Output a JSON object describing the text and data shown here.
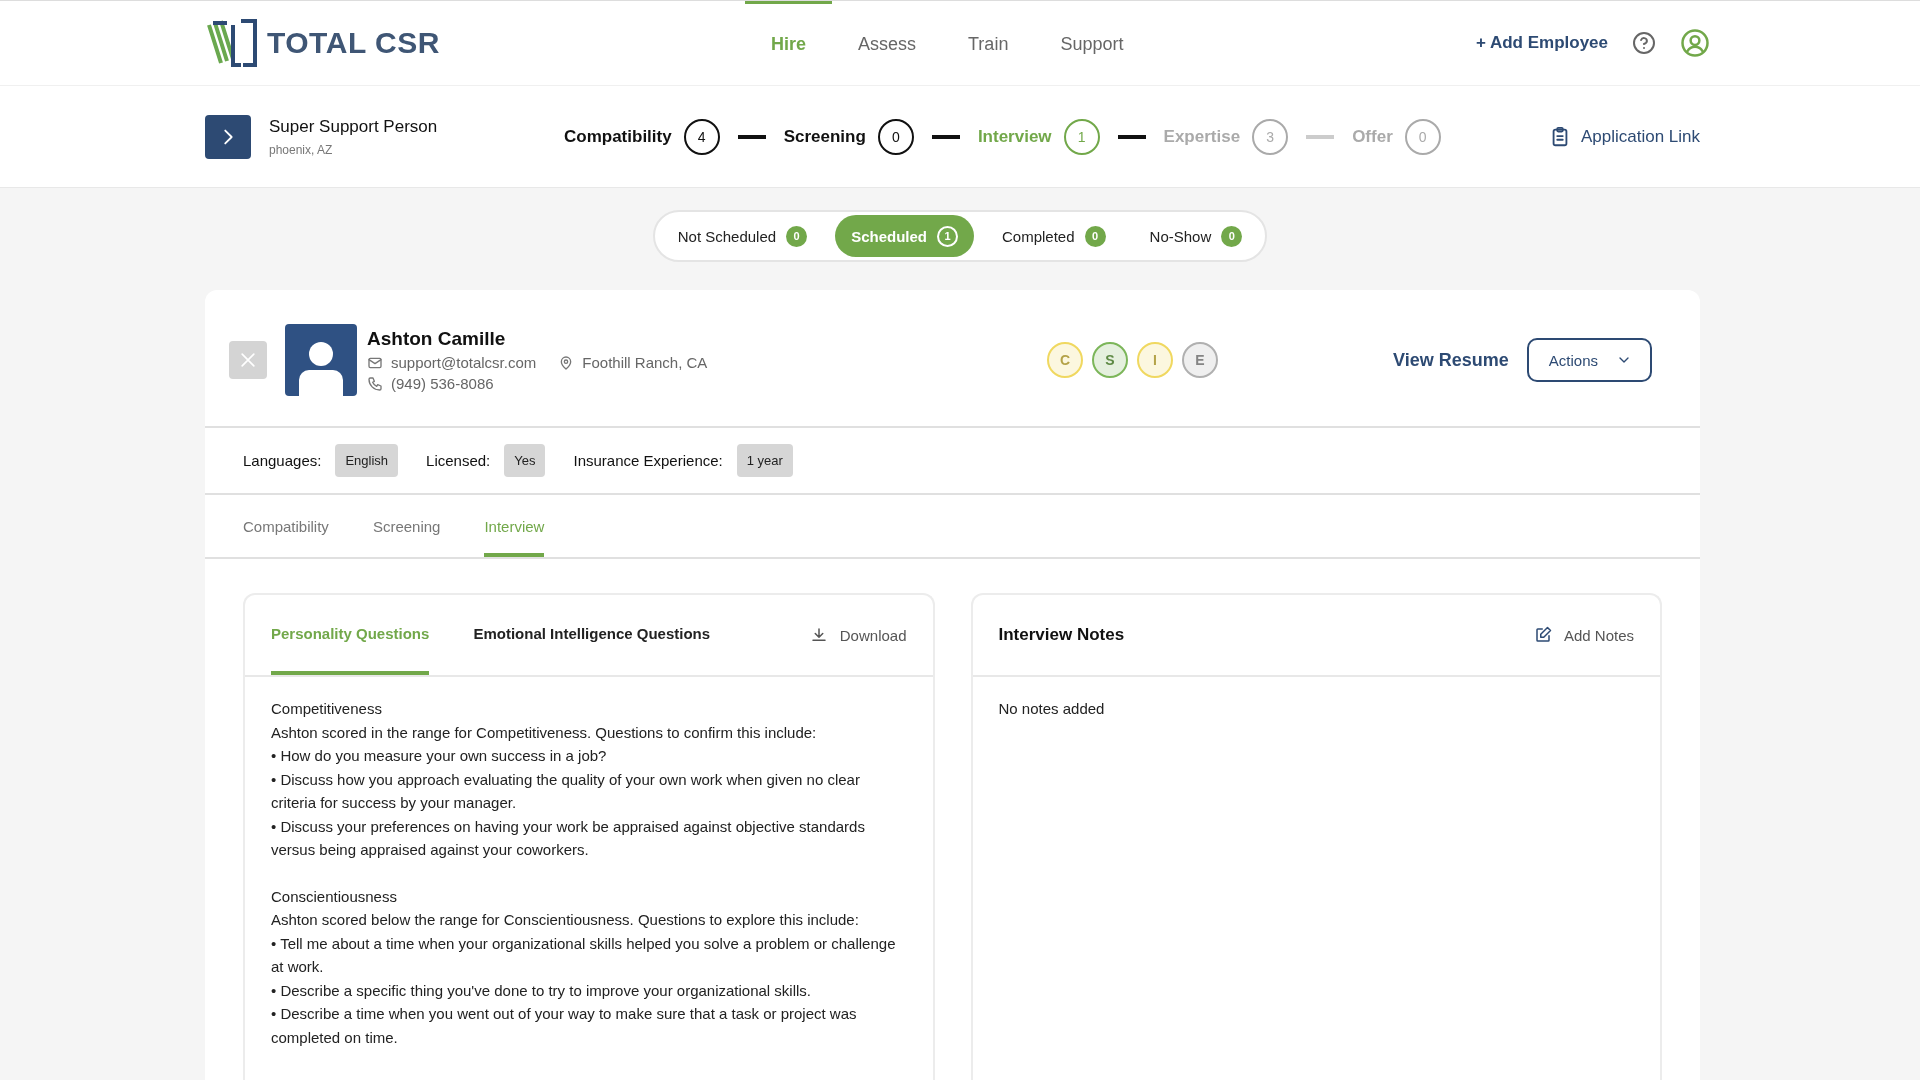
{
  "logo": {
    "text": "TOTAL CSR"
  },
  "nav": [
    {
      "label": "Hire",
      "selected": true
    },
    {
      "label": "Assess",
      "selected": false
    },
    {
      "label": "Train",
      "selected": false
    },
    {
      "label": "Support",
      "selected": false
    }
  ],
  "add_employee": "+ Add Employee",
  "job": {
    "title": "Super Support Person",
    "location": "phoenix, AZ"
  },
  "pipeline": [
    {
      "label": "Compatibility",
      "count": "4",
      "completed": true,
      "selected": false
    },
    {
      "label": "Screening",
      "count": "0",
      "completed": true,
      "selected": false
    },
    {
      "label": "Interview",
      "count": "1",
      "completed": false,
      "selected": true
    },
    {
      "label": "Expertise",
      "count": "3",
      "completed": false,
      "selected": false
    },
    {
      "label": "Offer",
      "count": "0",
      "completed": false,
      "selected": false
    }
  ],
  "application_link": "Application Link",
  "filters": [
    {
      "label": "Not Scheduled",
      "count": "0",
      "selected": false
    },
    {
      "label": "Scheduled",
      "count": "1",
      "selected": true
    },
    {
      "label": "Completed",
      "count": "0",
      "selected": false
    },
    {
      "label": "No-Show",
      "count": "0",
      "selected": false
    }
  ],
  "candidate": {
    "name": "Ashton Camille",
    "email": "support@totalcsr.com",
    "location": "Foothill Ranch, CA",
    "phone": "(949) 536-8086",
    "scores": [
      {
        "letter": "C",
        "color": "#f0d860"
      },
      {
        "letter": "S",
        "color": "#7cb65a"
      },
      {
        "letter": "I",
        "color": "#f0d860"
      },
      {
        "letter": "E",
        "color": "#b0b0b0"
      }
    ],
    "view_resume": "View Resume",
    "actions": "Actions",
    "attributes": [
      {
        "label": "Languages:",
        "value": "English"
      },
      {
        "label": "Licensed:",
        "value": "Yes"
      },
      {
        "label": "Insurance Experience:",
        "value": "1 year"
      }
    ]
  },
  "tabs": [
    {
      "label": "Compatibility",
      "selected": false
    },
    {
      "label": "Screening",
      "selected": false
    },
    {
      "label": "Interview",
      "selected": true
    }
  ],
  "questions": {
    "tabs": [
      {
        "label": "Personality Questions",
        "selected": true
      },
      {
        "label": "Emotional Intelligence Questions",
        "selected": false
      }
    ],
    "download": "Download",
    "sections": [
      {
        "title": "Competitiveness",
        "lines": [
          "Ashton scored in the range for Competitiveness. Questions to confirm this include:",
          "• How do you measure your own success in a job?",
          "• Discuss how you approach evaluating the quality of your own work when given no clear criteria for success by your manager.",
          "• Discuss your preferences on having your work be appraised against objective standards versus being appraised against your coworkers."
        ]
      },
      {
        "title": "Conscientiousness",
        "lines": [
          "Ashton scored below the range for Conscientiousness. Questions to explore this include:",
          "• Tell me about a time when your organizational skills helped you solve a problem or challenge at work.",
          "• Describe a specific thing you've done to try to improve your organizational skills.",
          "• Describe a time when you went out of your way to make sure that a task or project was completed on time."
        ]
      }
    ]
  },
  "notes": {
    "title": "Interview Notes",
    "add": "Add Notes",
    "empty": "No notes added"
  }
}
